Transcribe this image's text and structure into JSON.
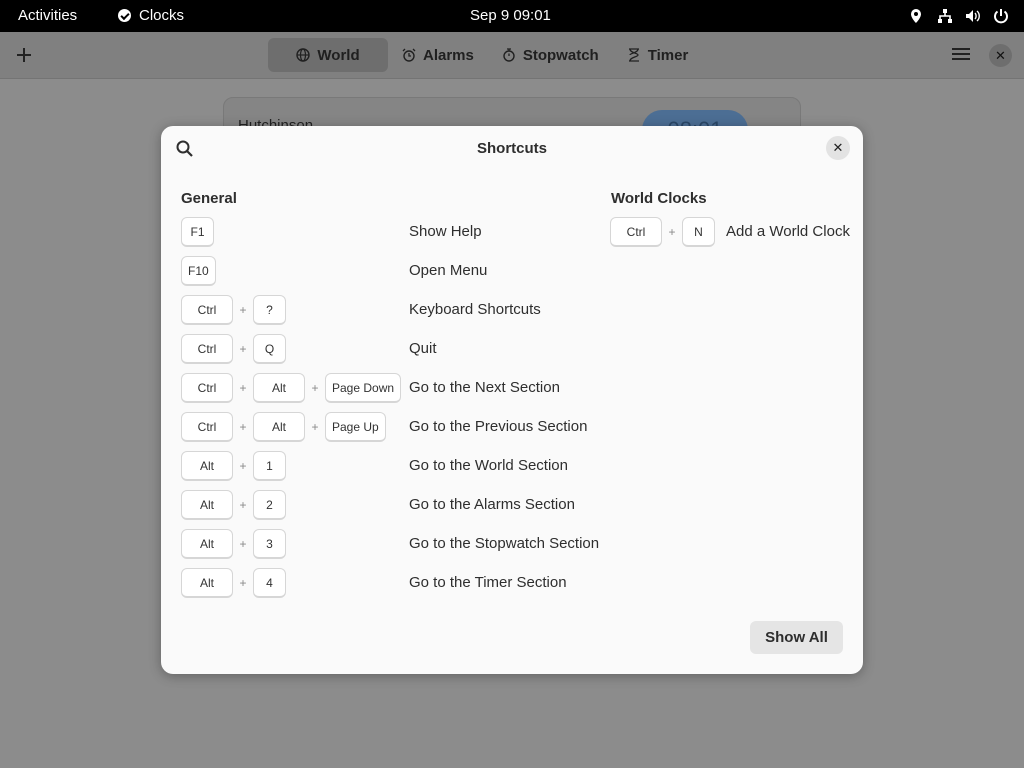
{
  "topbar": {
    "activities": "Activities",
    "app_name": "Clocks",
    "datetime": "Sep 9  09:01",
    "tray_icons": [
      "location-icon",
      "network-icon",
      "volume-icon",
      "power-icon"
    ]
  },
  "header": {
    "tabs": [
      {
        "label": "World",
        "icon": "globe-icon",
        "active": true
      },
      {
        "label": "Alarms",
        "icon": "alarm-icon",
        "active": false
      },
      {
        "label": "Stopwatch",
        "icon": "stopwatch-icon",
        "active": false
      },
      {
        "label": "Timer",
        "icon": "hourglass-icon",
        "active": false
      }
    ]
  },
  "background_card": {
    "city": "Hutchinson",
    "time": "08:01"
  },
  "dialog": {
    "title": "Shortcuts",
    "general": {
      "heading": "General",
      "rows": [
        {
          "keys": [
            "F1"
          ],
          "desc": "Show Help"
        },
        {
          "keys": [
            "F10"
          ],
          "desc": "Open Menu"
        },
        {
          "keys": [
            "Ctrl",
            "?"
          ],
          "desc": "Keyboard Shortcuts"
        },
        {
          "keys": [
            "Ctrl",
            "Q"
          ],
          "desc": "Quit"
        },
        {
          "keys": [
            "Ctrl",
            "Alt",
            "Page Down"
          ],
          "desc": "Go to the Next Section"
        },
        {
          "keys": [
            "Ctrl",
            "Alt",
            "Page Up"
          ],
          "desc": "Go to the Previous Section"
        },
        {
          "keys": [
            "Alt",
            "1"
          ],
          "desc": "Go to the World Section"
        },
        {
          "keys": [
            "Alt",
            "2"
          ],
          "desc": "Go to the Alarms Section"
        },
        {
          "keys": [
            "Alt",
            "3"
          ],
          "desc": "Go to the Stopwatch Section"
        },
        {
          "keys": [
            "Alt",
            "4"
          ],
          "desc": "Go to the Timer Section"
        }
      ]
    },
    "world_clocks": {
      "heading": "World Clocks",
      "rows": [
        {
          "keys": [
            "Ctrl",
            "N"
          ],
          "desc": "Add a World Clock"
        }
      ]
    },
    "plus_sign": "+",
    "show_all": "Show All"
  }
}
